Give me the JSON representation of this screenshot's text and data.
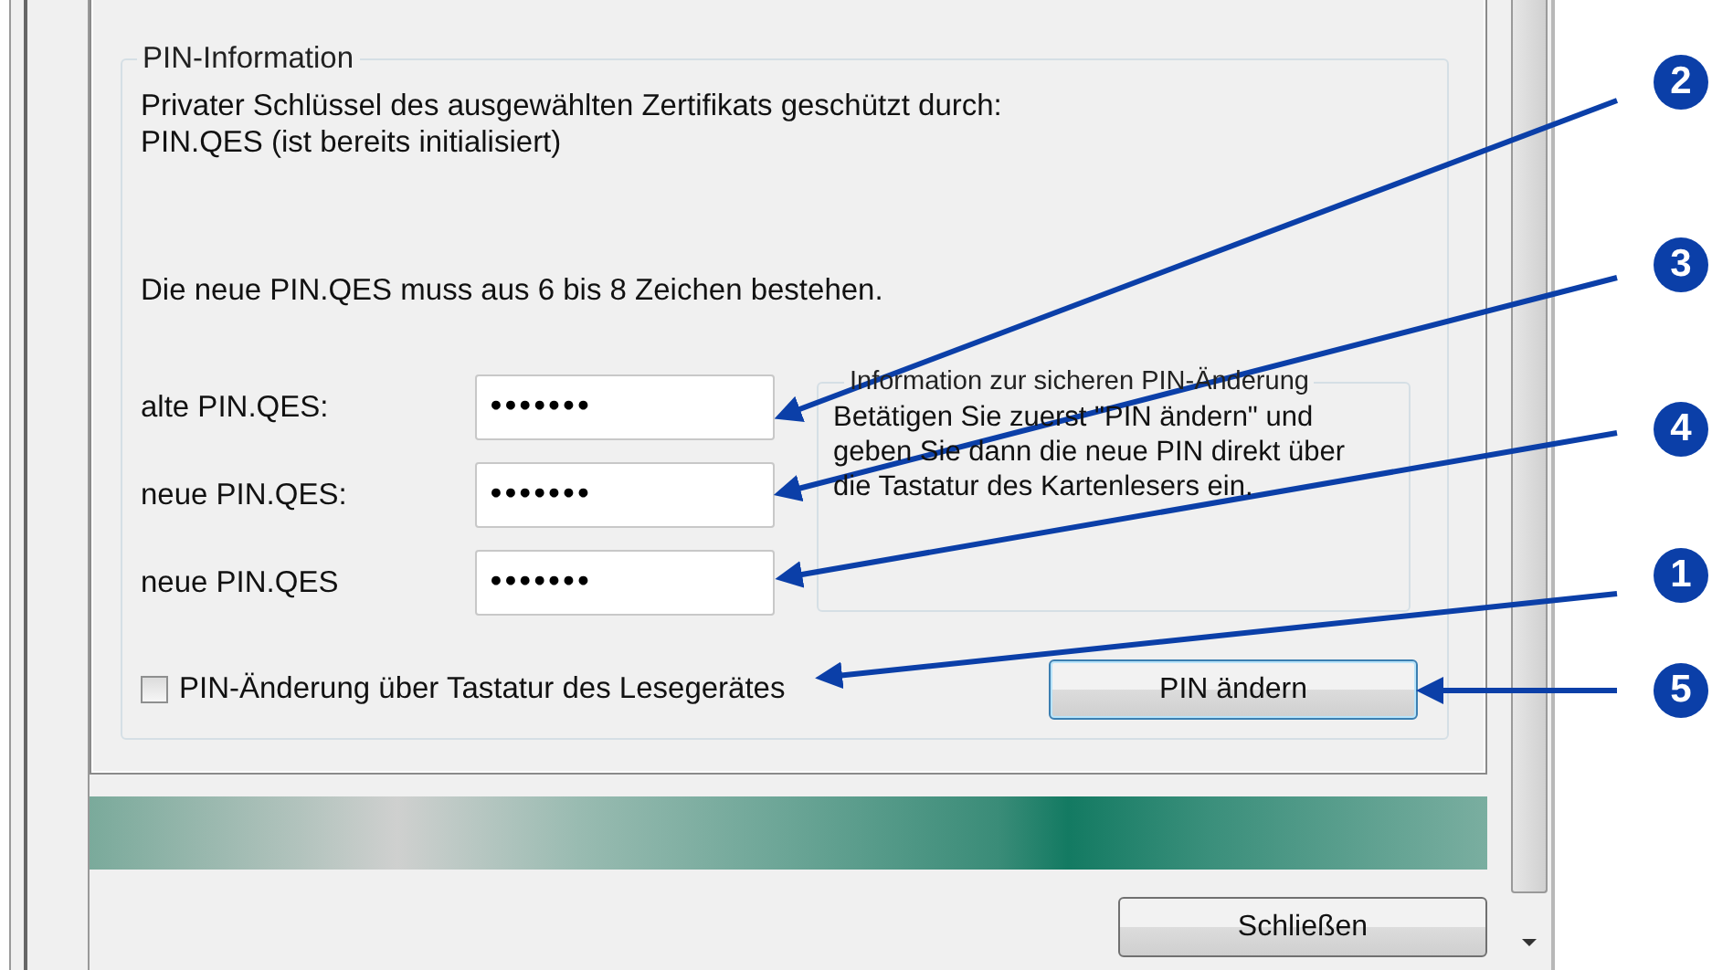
{
  "pin_information": {
    "title": "PIN-Information",
    "key_info": "Privater Schlüssel des ausgewählten Zertifikats geschützt durch:",
    "pin_status": "PIN.QES  (ist bereits initialisiert)",
    "rule": "Die neue PIN.QES muss aus 6 bis 8 Zeichen bestehen.",
    "fields": [
      {
        "label": "alte PIN.QES:",
        "value": "•••••••"
      },
      {
        "label": "neue PIN.QES:",
        "value": "•••••••"
      },
      {
        "label": "neue PIN.QES",
        "value": "•••••••"
      }
    ],
    "info_box": {
      "title": "Information zur sicheren PIN-Änderung",
      "text_lines": [
        "Betätigen Sie zuerst \"PIN ändern\" und",
        "geben Sie dann die neue PIN direkt über",
        "die Tastatur des Kartenlesers ein."
      ]
    },
    "reader_keypad": {
      "label": "PIN-Änderung über Tastatur des Lesegerätes",
      "checked": false
    },
    "change_button": "PIN ändern"
  },
  "close_button": "Schließen",
  "callouts": [
    {
      "number": "2"
    },
    {
      "number": "3"
    },
    {
      "number": "4"
    },
    {
      "number": "1"
    },
    {
      "number": "5"
    }
  ]
}
